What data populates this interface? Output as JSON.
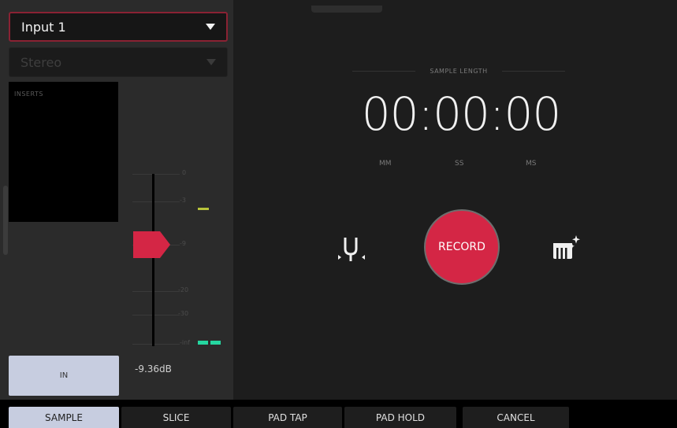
{
  "colors": {
    "record": "#d42645",
    "accent_border": "#8a2233",
    "active_tab": "#c7cde0",
    "meter_peak_yellow": "#b8c43a",
    "meter_level_teal": "#25d6a0"
  },
  "input": {
    "selected": "Input 1"
  },
  "channel_mode": {
    "selected": "Stereo"
  },
  "inserts": {
    "label": "INSERTS"
  },
  "meter": {
    "ticks": [
      "0",
      "-3",
      "-9",
      "-20",
      "-30",
      "-inf"
    ],
    "db_readout": "-9.36dB"
  },
  "in_button": {
    "label": "IN"
  },
  "sample_length": {
    "label": "SAMPLE LENGTH",
    "time": "00:00:00",
    "units": [
      "MM",
      "SS",
      "MS"
    ]
  },
  "icons": {
    "tuner": "tuner-fork-icon",
    "keyboard": "keyboard-magic-icon"
  },
  "record_button": {
    "label": "RECORD"
  },
  "tabs": [
    {
      "label": "SAMPLE",
      "active": true
    },
    {
      "label": "SLICE",
      "active": false
    },
    {
      "label": "PAD TAP",
      "active": false
    },
    {
      "label": "PAD HOLD",
      "active": false
    },
    {
      "label": "CANCEL",
      "active": false
    }
  ]
}
